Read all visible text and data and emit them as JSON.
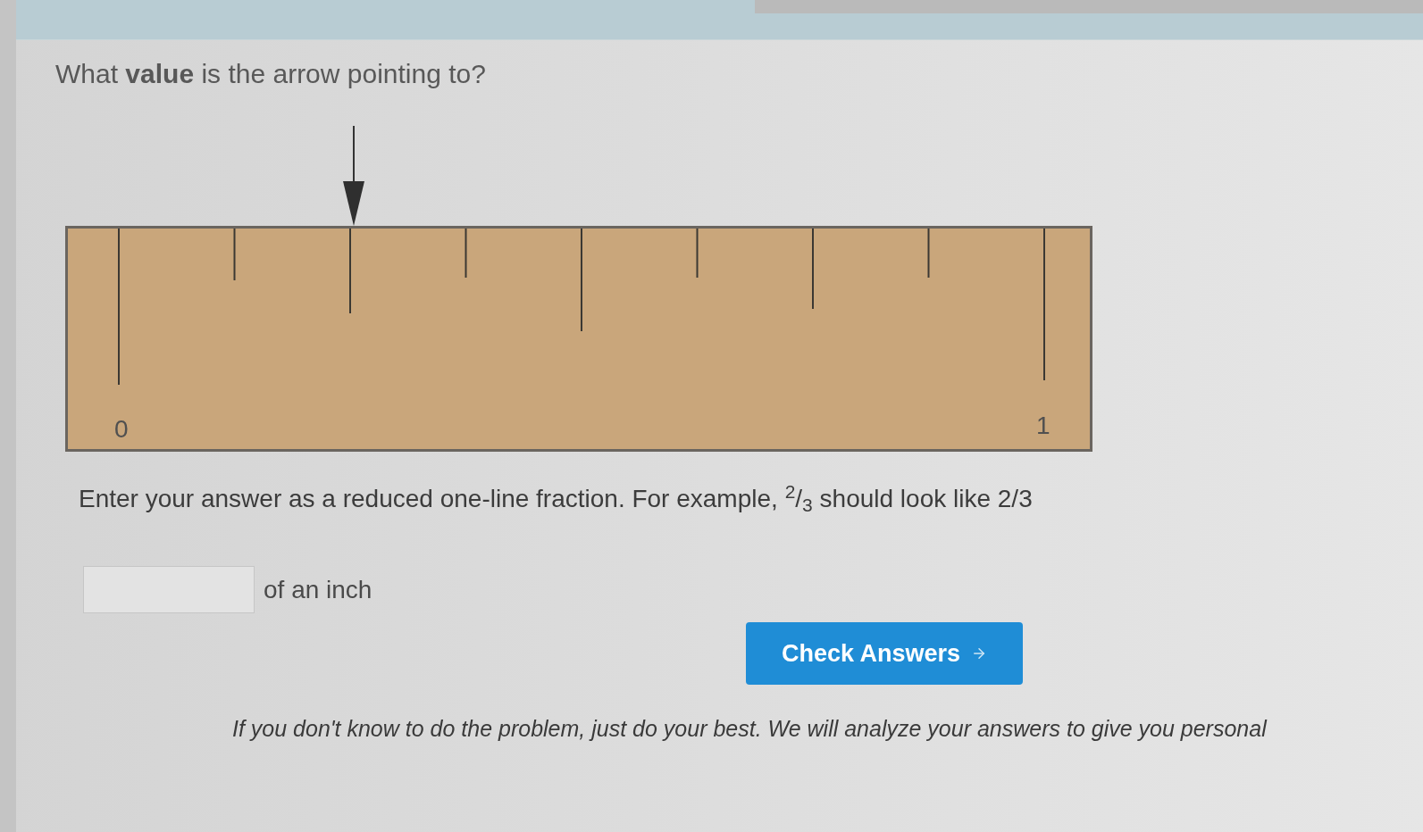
{
  "question": "What **value** is the arrow pointing to?",
  "ruler": {
    "labels": [
      "0",
      "1"
    ]
  },
  "instructions": "Enter your answer as a reduced one-line fraction. For example, $^{2}$/$_{3}$ should look like 2/3",
  "answer": {
    "unit": "of an inch"
  },
  "check_button": {
    "label": "Check Answers"
  },
  "footnote": "If you don't know to do the problem, just do your best. We will analyze your answers to give you personal"
}
